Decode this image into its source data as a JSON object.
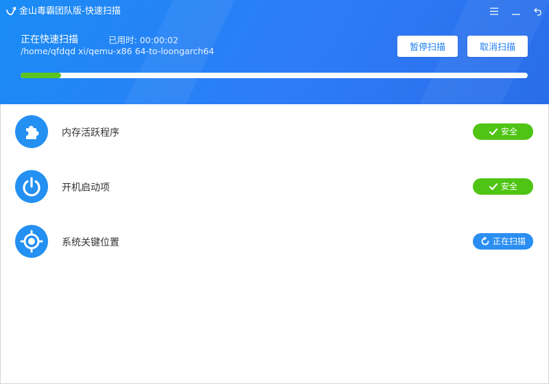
{
  "window": {
    "title": "金山毒霸团队版-快速扫描",
    "controls": [
      "menu-icon",
      "minimize-icon",
      "back-icon"
    ]
  },
  "scan": {
    "status_text": "正在快速扫描",
    "elapsed_text": "已用时: 00:00:02",
    "current_path": "/home/qfdqd xi/qemu-x86 64-to-loongarch64",
    "progress": 0.08,
    "pause_label": "暂停扫描",
    "cancel_label": "取消扫描"
  },
  "items": [
    {
      "label": "内存活跃程序",
      "icon": "puzzle-icon",
      "status": "安全",
      "state": "safe"
    },
    {
      "label": "开机启动项",
      "icon": "power-icon",
      "status": "安全",
      "state": "safe"
    },
    {
      "label": "系统关键位置",
      "icon": "crosshair-icon",
      "status": "正在扫描",
      "state": "scanning"
    }
  ],
  "colors": {
    "header_blue": "#2a7ef4",
    "progress_green": "#5cc320",
    "safe_green": "#4fc414",
    "scanning_blue": "#2a8ef2",
    "icon_blue": "#2490f2"
  }
}
